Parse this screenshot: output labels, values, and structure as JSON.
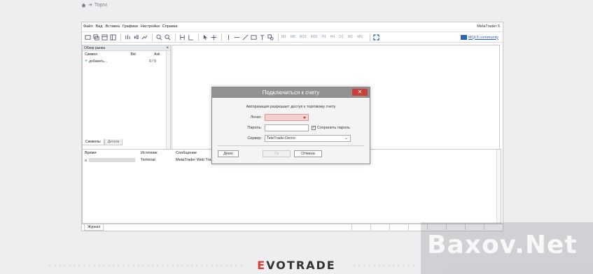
{
  "breadcrumb": {
    "label": "Торги"
  },
  "app": {
    "brand": "MetaTrader 5",
    "menu": [
      "Файл",
      "Вид",
      "Вставка",
      "Графики",
      "Настройки",
      "Справка"
    ],
    "timeframes": [
      "M1",
      "M5",
      "M15",
      "M30",
      "H1",
      "H4",
      "D1",
      "W1",
      "MN"
    ],
    "community": "MQL5.community"
  },
  "market_watch": {
    "title": "Обзор рынка",
    "columns": [
      "Символ",
      "Bid",
      "Ask"
    ],
    "add_label": "добавить...",
    "count": "0 / 0",
    "tabs": [
      "Символы",
      "Детали"
    ]
  },
  "journal": {
    "columns": [
      "Время",
      "Источник",
      "Сообщение"
    ],
    "rows": [
      {
        "source": "Terminal",
        "message": "MetaTrader Web Tra"
      }
    ],
    "tab": "Журнал"
  },
  "dialog": {
    "title": "Подключиться к счету",
    "subtitle": "Авторизация разрешает доступ к торговому счету",
    "login_label": "Логин:",
    "password_label": "Пароль:",
    "save_password_label": "Сохранить пароль",
    "server_label": "Сервер:",
    "server_value": "TeleTrade-Demo",
    "demo_button": "Демо",
    "ok_button": "Ок",
    "cancel_button": "Отмена"
  },
  "footer": {
    "logo_prefix": "E",
    "logo_rest": "VOTRADE"
  },
  "watermark": {
    "text": "Baxov.Net"
  },
  "colors": {
    "dialog_title_bg": "#919191",
    "close_button": "#c8403a",
    "login_error_bg": "#f6cfcf",
    "logo_accent": "#d63a32"
  }
}
